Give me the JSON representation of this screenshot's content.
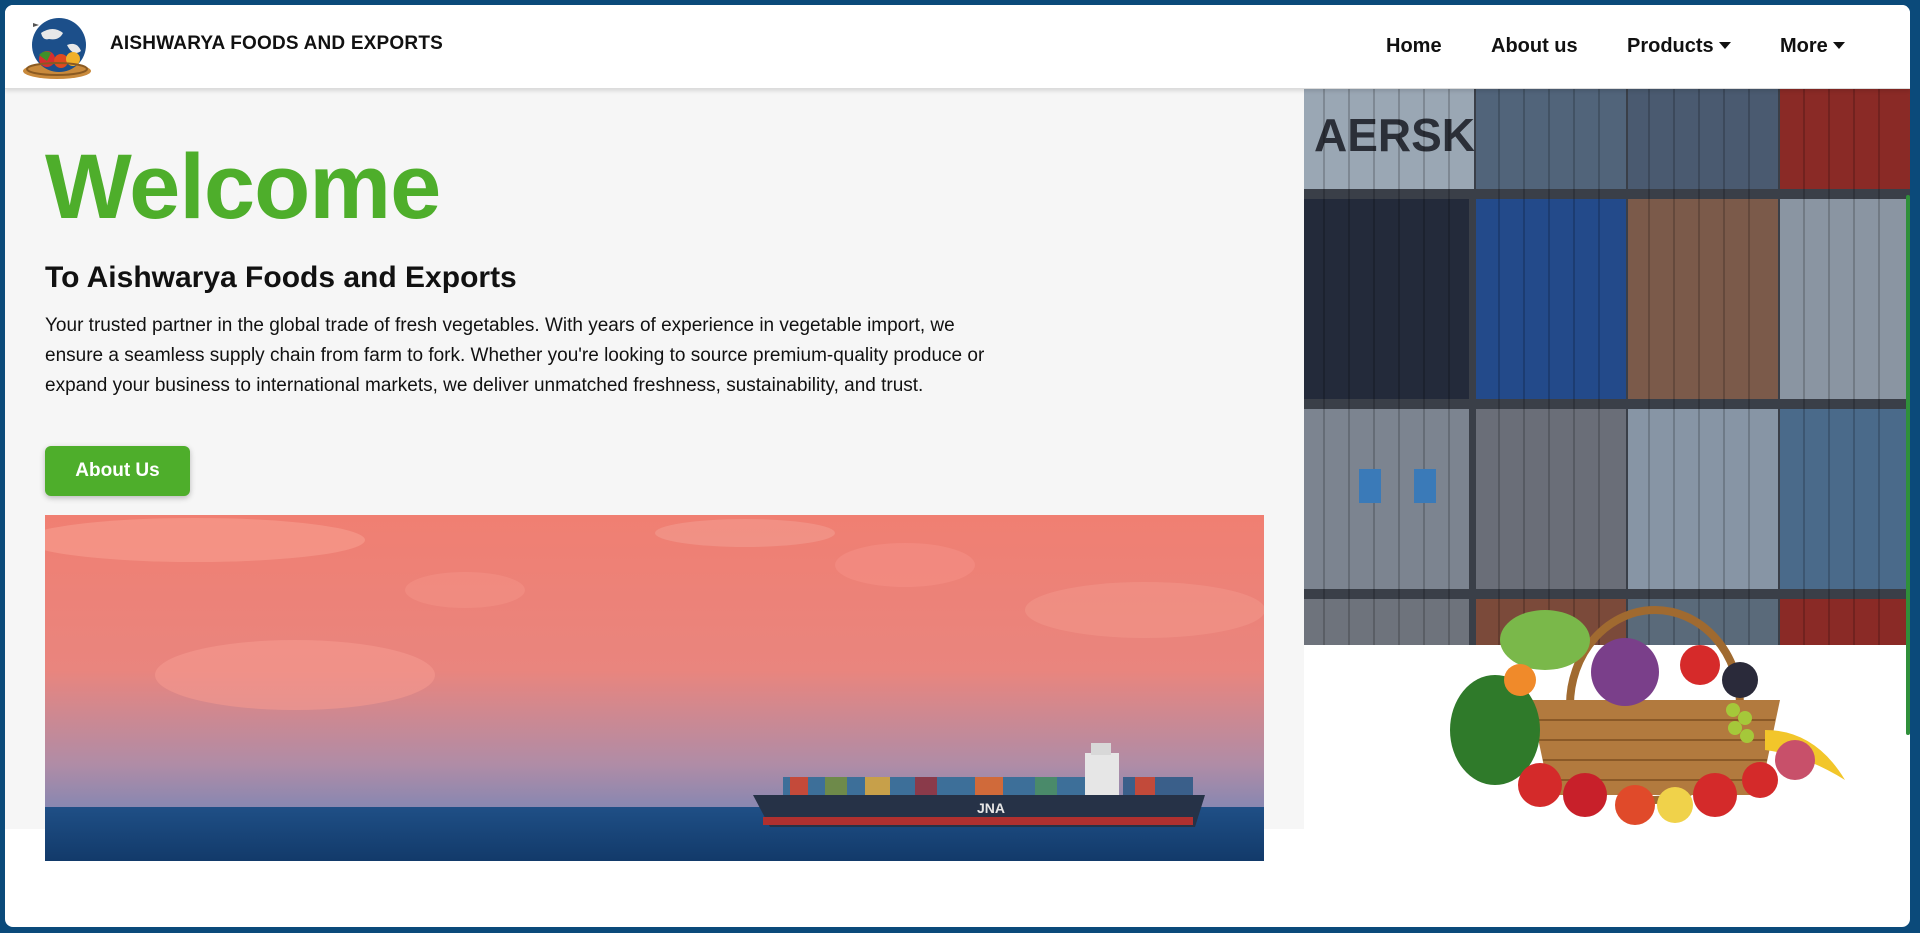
{
  "header": {
    "brand": "AISHWARYA FOODS AND EXPORTS",
    "nav": {
      "home": "Home",
      "about": "About us",
      "products": "Products",
      "more": "More"
    }
  },
  "hero": {
    "welcome": "Welcome",
    "subtitle": "To Aishwarya Foods and Exports",
    "intro": "Your trusted partner in the global trade of fresh vegetables. With years of experience in vegetable import, we ensure a seamless supply chain from farm to fork. Whether you're looking to source premium-quality produce or expand your business to international markets, we deliver unmatched freshness, sustainability, and trust.",
    "cta": "About Us"
  },
  "colors": {
    "accent": "#4eae2b",
    "frame": "#0b4a7a",
    "panel": "#f6f6f6"
  },
  "images": {
    "logo": "globe-fruit-basket-logo",
    "containers": "shipping-containers-photo",
    "ship": "cargo-ship-sunset-photo",
    "basket": "vegetable-basket-photo"
  }
}
